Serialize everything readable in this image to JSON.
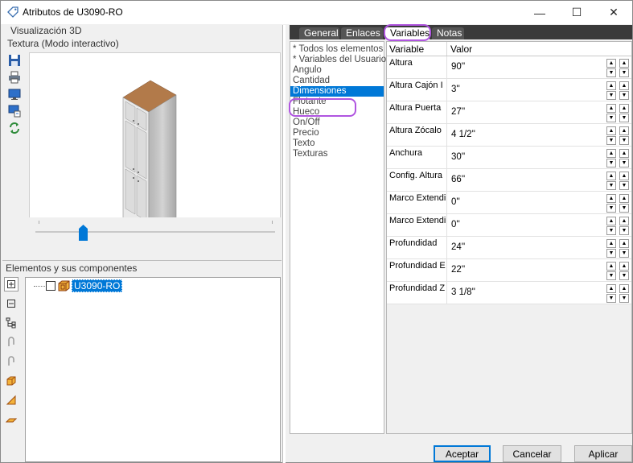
{
  "window": {
    "title": "Atributos de U3090-RO",
    "minimize": "—",
    "maximize": "☐",
    "close": "✕"
  },
  "left": {
    "viz_label": "Visualización 3D",
    "mode_label": "Textura (Modo interactivo)",
    "components_label": "Elementos y sus componentes",
    "tree_item": "U3090-RO",
    "slider_value": 0.2
  },
  "tabs": [
    {
      "label": "General"
    },
    {
      "label": "Enlaces"
    },
    {
      "label": "Variables"
    },
    {
      "label": "Notas"
    }
  ],
  "categories": [
    "* Todos los elementos",
    "* Variables del Usuario",
    "Angulo",
    "Cantidad",
    "Dimensiones",
    "Flotante",
    "Hueco",
    "On/Off",
    "Precio",
    "Texto",
    "Texturas"
  ],
  "selected_category": "Dimensiones",
  "table": {
    "col_variable": "Variable",
    "col_value": "Valor",
    "rows": [
      {
        "name": "Altura",
        "value": "90''"
      },
      {
        "name": "Altura Cajón I",
        "value": "3''"
      },
      {
        "name": "Altura Puerta",
        "value": "27''"
      },
      {
        "name": "Altura Zócalo",
        "value": "4 1/2''"
      },
      {
        "name": "Anchura",
        "value": "30''"
      },
      {
        "name": "Config. Altura",
        "value": "66''"
      },
      {
        "name": "Marco Extendi",
        "value": "0''"
      },
      {
        "name": "Marco Extendi",
        "value": "0''"
      },
      {
        "name": "Profundidad",
        "value": "24''"
      },
      {
        "name": "Profundidad E",
        "value": "22''"
      },
      {
        "name": "Profundidad Z",
        "value": "3 1/8''"
      }
    ]
  },
  "buttons": {
    "accept": "Aceptar",
    "cancel": "Cancelar",
    "apply": "Aplicar"
  },
  "colors": {
    "selection": "#0078d7",
    "highlight_circle": "#b055e0"
  }
}
